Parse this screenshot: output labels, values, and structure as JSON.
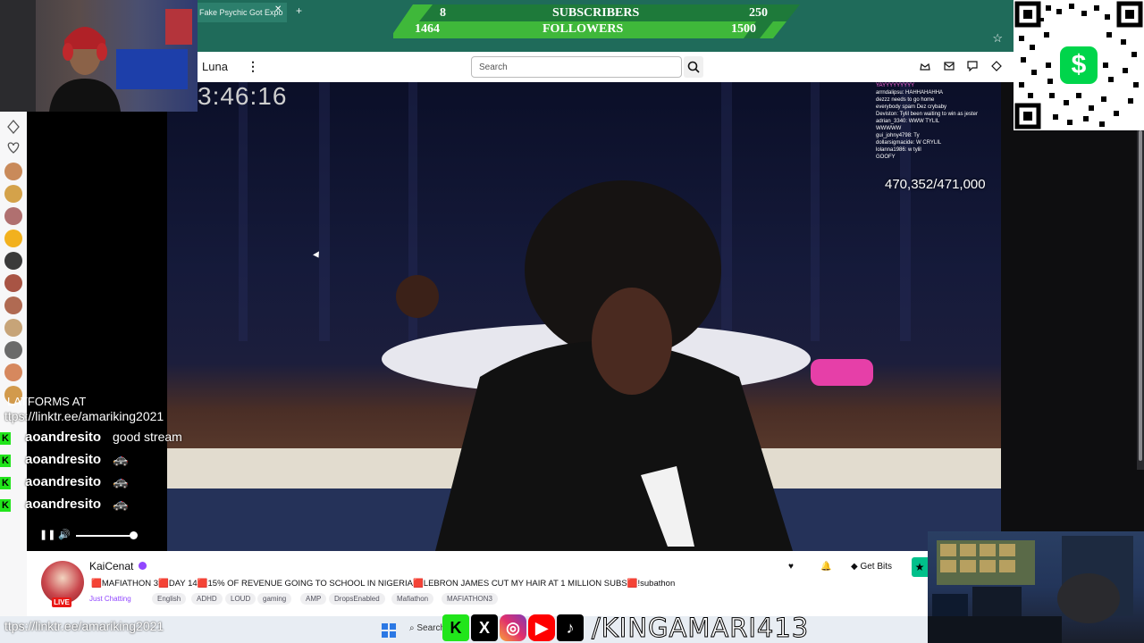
{
  "browser": {
    "tab_title": "Fake Psychic Got Expo",
    "tab_close": "✕",
    "new_tab": "+"
  },
  "nav": {
    "channel_fragment": "Luna",
    "search_placeholder": "Search"
  },
  "overlay": {
    "stream_timer": "3:46:16",
    "viewer_progress": "470,352/471,000",
    "goals": {
      "subscribers": {
        "current": "8",
        "label": "SUBSCRIBERS",
        "goal": "250"
      },
      "followers": {
        "current": "1464",
        "label": "FOLLOWERS",
        "goal": "1500"
      }
    },
    "cashapp_symbol": "$",
    "platforms_text": "LATFORMS AT",
    "linktree": "ttps://linktr.ee/amariking2021",
    "linktree_bottom": "ttps://linktr.ee/amariking2021",
    "handle": "/KINGAMARI413",
    "mini_chat": [
      "YAYYYYYYYYY",
      "arrndalipsu: HAHHAHAHHA",
      "dezzz needs to go home",
      "everybody spam Dez crybaby",
      "Deviston: Tylil been waiting to win as jester",
      "adrian_3340: WWW TYLIL",
      "WWWWW",
      "gui_johny4798: Ty",
      "dollarsigmacide: W CRYLIL",
      "lolanna1986: w tylil",
      "GOOFY"
    ]
  },
  "chat": [
    {
      "user": "aoandresito",
      "message": "good stream"
    },
    {
      "user": "aoandresito",
      "message": ""
    },
    {
      "user": "aoandresito",
      "message": ""
    },
    {
      "user": "aoandresito",
      "message": ""
    }
  ],
  "channel": {
    "name": "KaiCenat",
    "live_badge": "LIVE",
    "title": "🟥MAFIATHON 3🟥DAY 14🟥15% OF REVENUE GOING TO SCHOOL IN NIGERIA🟥LEBRON JAMES CUT MY HAIR AT 1 MILLION SUBS🟥!subathon",
    "category": "Just Chatting",
    "tags": [
      "English",
      "ADHD",
      "LOUD",
      "gaming",
      "AMP",
      "DropsEnabled",
      "Mafiathon",
      "MAFIATHON3"
    ],
    "get_bits_label": "Get Bits"
  },
  "taskbar": {
    "search_label": "Search"
  },
  "colors": {
    "goal_green": "#3fb83a",
    "goal_dark": "#1e7a3a",
    "browser_teal": "#1f6b5a",
    "twitch_purple": "#9147ff",
    "kick_green": "#21e51b",
    "cashapp_green": "#00d54b"
  }
}
